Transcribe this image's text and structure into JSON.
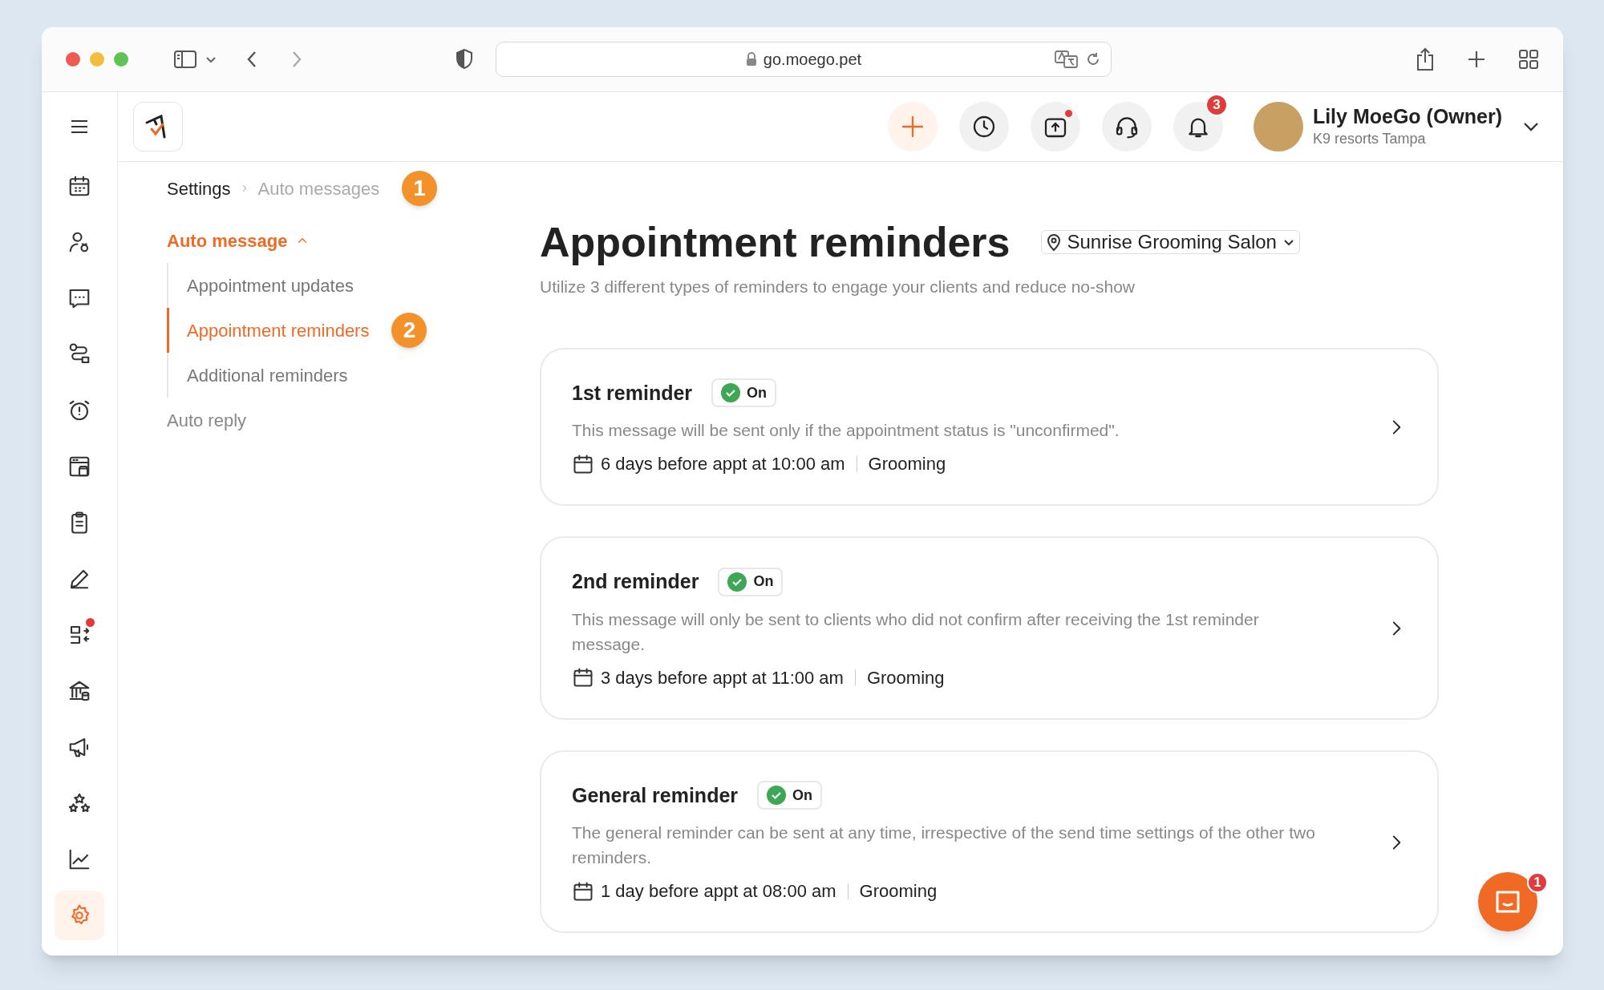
{
  "browser": {
    "url": "go.moego.pet"
  },
  "rail": [
    {
      "kind": "calendar",
      "selected": false,
      "dot": false
    },
    {
      "kind": "client",
      "selected": false,
      "dot": false
    },
    {
      "kind": "message",
      "selected": false,
      "dot": false
    },
    {
      "kind": "route",
      "selected": false,
      "dot": false
    },
    {
      "kind": "alarm",
      "selected": false,
      "dot": false
    },
    {
      "kind": "store",
      "selected": false,
      "dot": false
    },
    {
      "kind": "clipboard",
      "selected": false,
      "dot": false
    },
    {
      "kind": "pen",
      "selected": false,
      "dot": false
    },
    {
      "kind": "exchange",
      "selected": false,
      "dot": true
    },
    {
      "kind": "bank",
      "selected": false,
      "dot": false
    },
    {
      "kind": "megaphone",
      "selected": false,
      "dot": false
    },
    {
      "kind": "stars",
      "selected": false,
      "dot": false
    },
    {
      "kind": "chart",
      "selected": false,
      "dot": false
    },
    {
      "kind": "gear",
      "selected": true,
      "dot": false
    }
  ],
  "header": {
    "actions": [
      {
        "kind": "add",
        "dot": false
      },
      {
        "kind": "clock",
        "dot": false
      },
      {
        "kind": "upload",
        "dot": true
      },
      {
        "kind": "headset",
        "dot": false
      },
      {
        "kind": "bell",
        "dot": false,
        "badge": "3"
      }
    ],
    "user": {
      "name": "Lily MoeGo (Owner)",
      "business": "K9 resorts Tampa"
    }
  },
  "breadcrumb": {
    "items": [
      "Settings",
      "Auto messages"
    ],
    "callout": "1"
  },
  "nav": [
    {
      "label": "Auto message",
      "selected": true,
      "expanded": true,
      "children": [
        {
          "label": "Appointment updates",
          "selected": false
        },
        {
          "label": "Appointment reminders",
          "selected": true,
          "callout": "2"
        },
        {
          "label": "Additional reminders",
          "selected": false
        }
      ]
    },
    {
      "label": "Auto reply",
      "selected": false
    }
  ],
  "page": {
    "title": "Appointment reminders",
    "location": "Sunrise Grooming Salon",
    "subtitle": "Utilize 3 different types of reminders to engage your clients and reduce no-show"
  },
  "reminders": [
    {
      "title": "1st reminder",
      "status": "On",
      "on": true,
      "description": "This message will be sent only if the appointment status is \"unconfirmed\".",
      "schedule": "6 days before appt at 10:00 am",
      "service": "Grooming"
    },
    {
      "title": "2nd reminder",
      "status": "On",
      "on": true,
      "description": "This message will only be sent to clients who did not confirm after receiving the 1st reminder message.",
      "schedule": "3 days before appt at 11:00 am",
      "service": "Grooming"
    },
    {
      "title": "General reminder",
      "status": "On",
      "on": true,
      "description": "The general reminder can be sent at any time, irrespective of the send time settings of the other two reminders.",
      "schedule": "1 day before appt at 08:00 am",
      "service": "Grooming"
    }
  ],
  "chat": {
    "badge": "1"
  }
}
